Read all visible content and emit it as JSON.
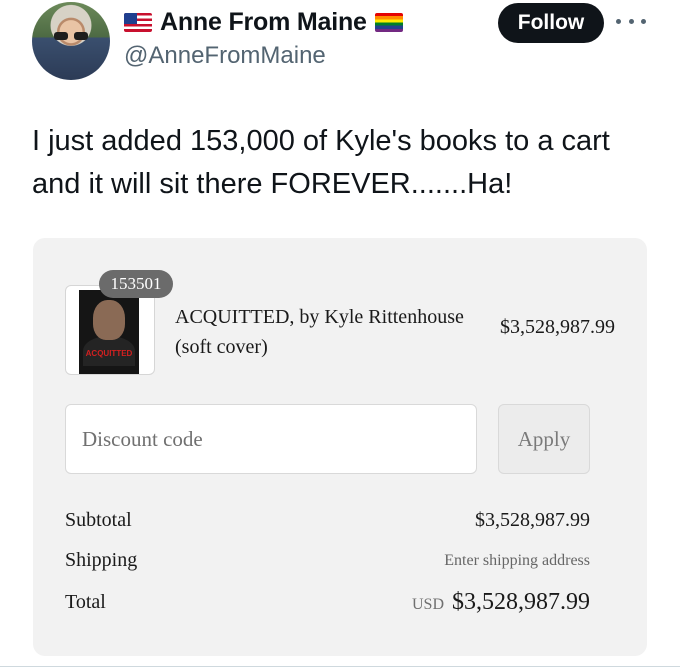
{
  "tweet": {
    "display_name": "Anne From Maine",
    "handle": "@AnneFromMaine",
    "follow_label": "Follow",
    "text": "I just added 153,000 of Kyle's books to a cart and it will sit there FOREVER.......Ha!"
  },
  "cart": {
    "item": {
      "quantity": "153501",
      "title": "ACQUITTED, by Kyle Rittenhouse (soft cover)",
      "price": "$3,528,987.99",
      "cover_title": "ACQUITTED"
    },
    "discount": {
      "placeholder": "Discount code",
      "apply_label": "Apply"
    },
    "summary": {
      "subtotal_label": "Subtotal",
      "subtotal_value": "$3,528,987.99",
      "shipping_label": "Shipping",
      "shipping_value": "Enter shipping address",
      "total_label": "Total",
      "currency": "USD",
      "total_value": "$3,528,987.99"
    }
  },
  "icons": {
    "flag": "us-flag-icon",
    "rainbow": "rainbow-flag-icon",
    "more": "more-options-icon"
  }
}
